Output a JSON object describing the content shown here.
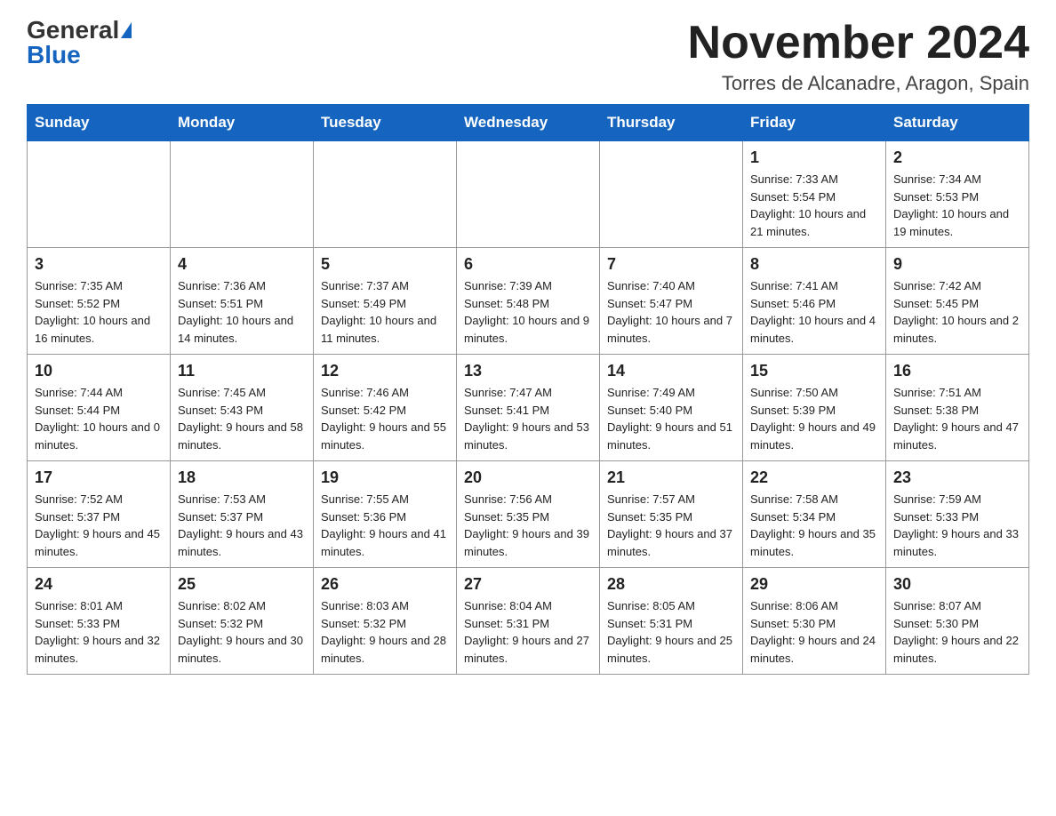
{
  "header": {
    "logo_general": "General",
    "logo_blue": "Blue",
    "month_title": "November 2024",
    "location": "Torres de Alcanadre, Aragon, Spain"
  },
  "weekdays": [
    "Sunday",
    "Monday",
    "Tuesday",
    "Wednesday",
    "Thursday",
    "Friday",
    "Saturday"
  ],
  "weeks": [
    [
      {
        "day": "",
        "info": ""
      },
      {
        "day": "",
        "info": ""
      },
      {
        "day": "",
        "info": ""
      },
      {
        "day": "",
        "info": ""
      },
      {
        "day": "",
        "info": ""
      },
      {
        "day": "1",
        "info": "Sunrise: 7:33 AM\nSunset: 5:54 PM\nDaylight: 10 hours and 21 minutes."
      },
      {
        "day": "2",
        "info": "Sunrise: 7:34 AM\nSunset: 5:53 PM\nDaylight: 10 hours and 19 minutes."
      }
    ],
    [
      {
        "day": "3",
        "info": "Sunrise: 7:35 AM\nSunset: 5:52 PM\nDaylight: 10 hours and 16 minutes."
      },
      {
        "day": "4",
        "info": "Sunrise: 7:36 AM\nSunset: 5:51 PM\nDaylight: 10 hours and 14 minutes."
      },
      {
        "day": "5",
        "info": "Sunrise: 7:37 AM\nSunset: 5:49 PM\nDaylight: 10 hours and 11 minutes."
      },
      {
        "day": "6",
        "info": "Sunrise: 7:39 AM\nSunset: 5:48 PM\nDaylight: 10 hours and 9 minutes."
      },
      {
        "day": "7",
        "info": "Sunrise: 7:40 AM\nSunset: 5:47 PM\nDaylight: 10 hours and 7 minutes."
      },
      {
        "day": "8",
        "info": "Sunrise: 7:41 AM\nSunset: 5:46 PM\nDaylight: 10 hours and 4 minutes."
      },
      {
        "day": "9",
        "info": "Sunrise: 7:42 AM\nSunset: 5:45 PM\nDaylight: 10 hours and 2 minutes."
      }
    ],
    [
      {
        "day": "10",
        "info": "Sunrise: 7:44 AM\nSunset: 5:44 PM\nDaylight: 10 hours and 0 minutes."
      },
      {
        "day": "11",
        "info": "Sunrise: 7:45 AM\nSunset: 5:43 PM\nDaylight: 9 hours and 58 minutes."
      },
      {
        "day": "12",
        "info": "Sunrise: 7:46 AM\nSunset: 5:42 PM\nDaylight: 9 hours and 55 minutes."
      },
      {
        "day": "13",
        "info": "Sunrise: 7:47 AM\nSunset: 5:41 PM\nDaylight: 9 hours and 53 minutes."
      },
      {
        "day": "14",
        "info": "Sunrise: 7:49 AM\nSunset: 5:40 PM\nDaylight: 9 hours and 51 minutes."
      },
      {
        "day": "15",
        "info": "Sunrise: 7:50 AM\nSunset: 5:39 PM\nDaylight: 9 hours and 49 minutes."
      },
      {
        "day": "16",
        "info": "Sunrise: 7:51 AM\nSunset: 5:38 PM\nDaylight: 9 hours and 47 minutes."
      }
    ],
    [
      {
        "day": "17",
        "info": "Sunrise: 7:52 AM\nSunset: 5:37 PM\nDaylight: 9 hours and 45 minutes."
      },
      {
        "day": "18",
        "info": "Sunrise: 7:53 AM\nSunset: 5:37 PM\nDaylight: 9 hours and 43 minutes."
      },
      {
        "day": "19",
        "info": "Sunrise: 7:55 AM\nSunset: 5:36 PM\nDaylight: 9 hours and 41 minutes."
      },
      {
        "day": "20",
        "info": "Sunrise: 7:56 AM\nSunset: 5:35 PM\nDaylight: 9 hours and 39 minutes."
      },
      {
        "day": "21",
        "info": "Sunrise: 7:57 AM\nSunset: 5:35 PM\nDaylight: 9 hours and 37 minutes."
      },
      {
        "day": "22",
        "info": "Sunrise: 7:58 AM\nSunset: 5:34 PM\nDaylight: 9 hours and 35 minutes."
      },
      {
        "day": "23",
        "info": "Sunrise: 7:59 AM\nSunset: 5:33 PM\nDaylight: 9 hours and 33 minutes."
      }
    ],
    [
      {
        "day": "24",
        "info": "Sunrise: 8:01 AM\nSunset: 5:33 PM\nDaylight: 9 hours and 32 minutes."
      },
      {
        "day": "25",
        "info": "Sunrise: 8:02 AM\nSunset: 5:32 PM\nDaylight: 9 hours and 30 minutes."
      },
      {
        "day": "26",
        "info": "Sunrise: 8:03 AM\nSunset: 5:32 PM\nDaylight: 9 hours and 28 minutes."
      },
      {
        "day": "27",
        "info": "Sunrise: 8:04 AM\nSunset: 5:31 PM\nDaylight: 9 hours and 27 minutes."
      },
      {
        "day": "28",
        "info": "Sunrise: 8:05 AM\nSunset: 5:31 PM\nDaylight: 9 hours and 25 minutes."
      },
      {
        "day": "29",
        "info": "Sunrise: 8:06 AM\nSunset: 5:30 PM\nDaylight: 9 hours and 24 minutes."
      },
      {
        "day": "30",
        "info": "Sunrise: 8:07 AM\nSunset: 5:30 PM\nDaylight: 9 hours and 22 minutes."
      }
    ]
  ]
}
